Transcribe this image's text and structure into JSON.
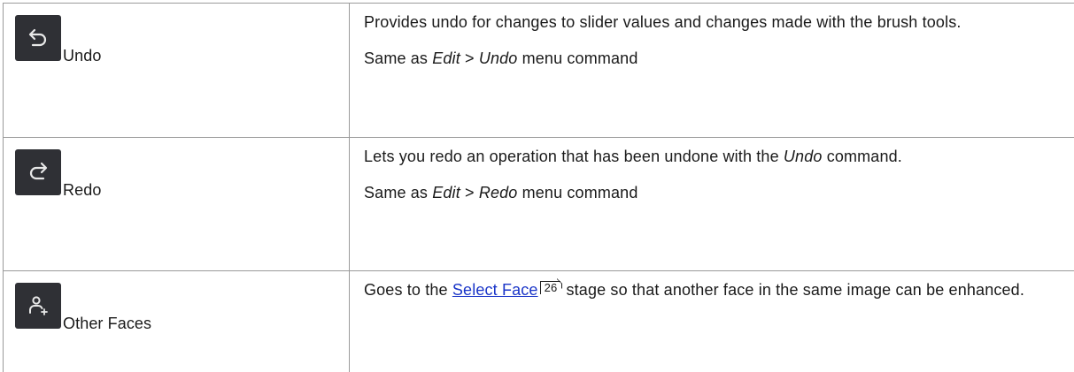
{
  "rows": [
    {
      "icon": "undo-arrow-icon",
      "command": "Undo",
      "desc_line": "Provides undo for changes to slider values and changes made with the brush tools.",
      "same_as_prefix": "Same as ",
      "same_as_menu": "Edit",
      "same_as_sep": " > ",
      "same_as_item": "Undo",
      "same_as_suffix": " menu command"
    },
    {
      "icon": "redo-arrow-icon",
      "command": "Redo",
      "desc_before": "Lets you redo an operation that has been undone with the ",
      "desc_italic": "Undo",
      "desc_after": " command.",
      "same_as_prefix": "Same as ",
      "same_as_menu": "Edit",
      "same_as_sep": " > ",
      "same_as_item": "Redo",
      "same_as_suffix": " menu command"
    },
    {
      "icon": "add-person-icon",
      "command": "Other Faces",
      "desc_before": "Goes to the ",
      "link_text": "Select Face",
      "page_ref": "26",
      "desc_after": " stage so that another face in the same image can be enhanced."
    }
  ],
  "colors": {
    "icon_background": "#2f3035",
    "icon_glyph": "#e8e8e8",
    "link": "#1a35c8",
    "border": "#9a9a9a"
  }
}
